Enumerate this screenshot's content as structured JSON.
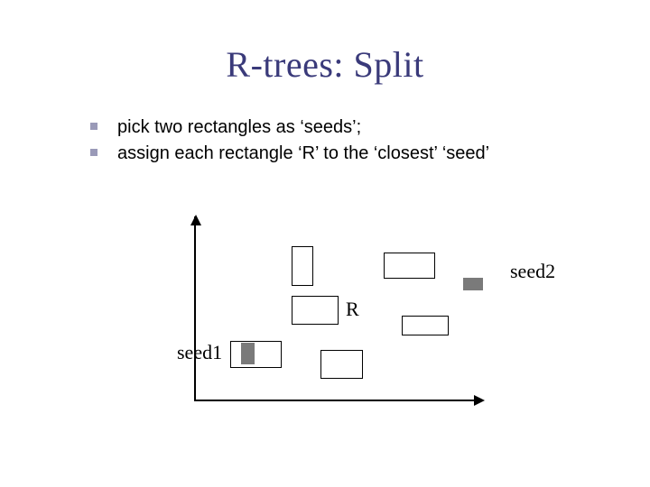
{
  "title": "R-trees: Split",
  "bullets": [
    "pick two rectangles as ‘seeds’;",
    "assign each rectangle ‘R’ to the ‘closest’ ‘seed’"
  ],
  "labels": {
    "R": "R",
    "seed1": "seed1",
    "seed2": "seed2"
  }
}
